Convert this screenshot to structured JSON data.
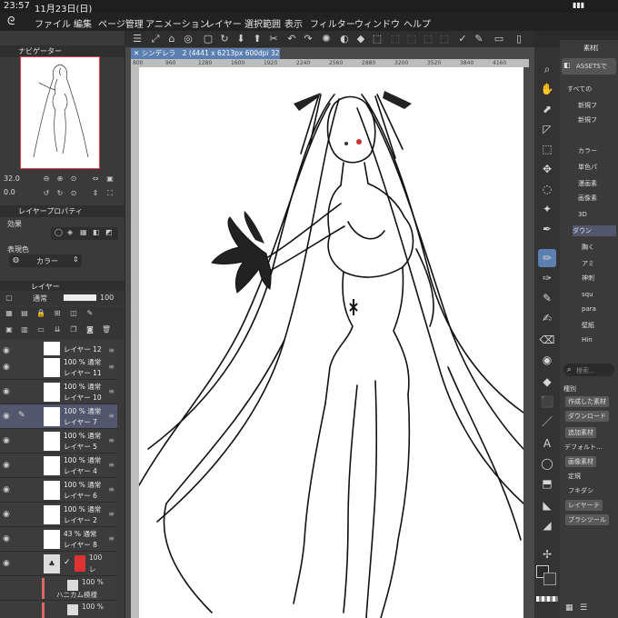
{
  "status": {
    "time": "23:57",
    "date": "11月23日(日)"
  },
  "menu": {
    "logo": "ᘓ",
    "items": [
      "ファイル",
      "編集",
      "ページ管理",
      "アニメーション",
      "レイヤー",
      "選択範囲",
      "表示",
      "フィルター",
      "ウィンドウ",
      "ヘルプ"
    ]
  },
  "toolbar": {
    "icons": [
      "☰",
      "⤢",
      "⌂",
      "◎",
      "▢",
      "↻",
      "⬇",
      "⬆",
      "✂",
      "↶",
      "↷",
      "✺",
      "◐",
      "◆",
      "⬚",
      "⬚",
      "⬚",
      "⬚",
      "⬚",
      "✓",
      "✎",
      "▭",
      "▯"
    ]
  },
  "navigator": {
    "title": "ナビゲーター",
    "zoom": "32.0",
    "rotate": "0.0"
  },
  "layer_property": {
    "title": "レイヤープロパティ",
    "effect_label": "効果",
    "color_label": "表現色",
    "color_value": "カラー"
  },
  "layer_panel": {
    "tab": "レイヤー",
    "blend": "通常",
    "opacity": "100",
    "layers": [
      {
        "op": "",
        "name": "レイヤー 12",
        "selected": false
      },
      {
        "op": "100 % 通常",
        "name": "レイヤー 11",
        "selected": false
      },
      {
        "op": "100 % 通常",
        "name": "レイヤー 10",
        "selected": false
      },
      {
        "op": "100 % 通常",
        "name": "レイヤー 7",
        "selected": true
      },
      {
        "op": "100 % 通常",
        "name": "レイヤー 5",
        "selected": false
      },
      {
        "op": "100 % 通常",
        "name": "レイヤー 4",
        "selected": false
      },
      {
        "op": "100 % 通常",
        "name": "レイヤー 6",
        "selected": false
      },
      {
        "op": "100 % 通常",
        "name": "レイヤー 2",
        "selected": false
      },
      {
        "op": "43 % 通常",
        "name": "レイヤー 8",
        "selected": false
      }
    ],
    "folder": {
      "op": "100",
      "name": "レ"
    },
    "sub1": {
      "op": "100 %",
      "name": "ハニカム模様"
    },
    "sub2": {
      "op": "100 %"
    }
  },
  "document": {
    "tab": "シンデレラ　2 (4441 x 6213px 600dpi 32.0%)",
    "ruler": [
      "800",
      "960",
      "1280",
      "1600",
      "1920",
      "2240",
      "2560",
      "2880",
      "3200",
      "3520",
      "3840",
      "4160"
    ]
  },
  "tools": [
    "⌕",
    "✋",
    "⬈",
    "◸",
    "⬚",
    "✥",
    "◌",
    "✦",
    "✒",
    "✏",
    "✑",
    "✎",
    "✍",
    "⌫",
    "◉",
    "◆",
    "⬛",
    "／",
    "A",
    "◯",
    "⬒",
    "◣",
    "◢",
    "✢"
  ],
  "material": {
    "title": "素材[",
    "assets_label": "ASSETSで",
    "tree": [
      "すべての",
      "新規フ",
      "新規フ",
      "カラー",
      "単色パ",
      "漫画素",
      "画像素",
      "3D",
      "ダウン",
      "胸く",
      "アミ",
      "神刺",
      "squ",
      "para",
      "壁紙",
      "Hin"
    ],
    "search_placeholder": "検索…",
    "kind_label": "種別",
    "chips": [
      "作成した素材",
      "ダウンロード",
      "追加素材",
      "デフォルト…",
      "画像素材",
      "定規",
      "フキダシ",
      "レイヤーテ",
      "ブラシツール"
    ]
  },
  "colors": {
    "selected_layer": "#51586d",
    "doc_tab": "#5a7fb0",
    "accent_red": "#e04040"
  }
}
